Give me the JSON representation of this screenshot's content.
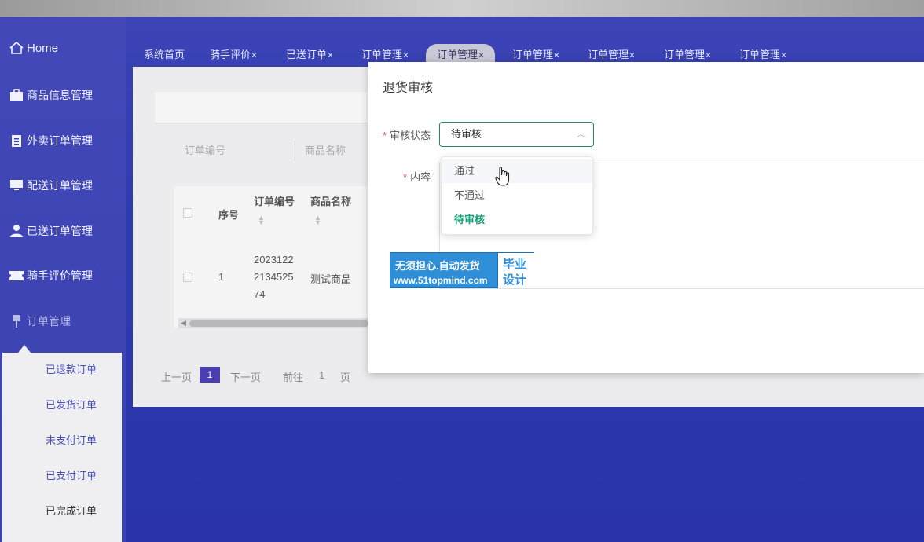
{
  "sidebar": {
    "home": "Home",
    "items": [
      {
        "label": "商品信息管理",
        "icon": "briefcase-icon"
      },
      {
        "label": "外卖订单管理",
        "icon": "clipboard-icon"
      },
      {
        "label": "配送订单管理",
        "icon": "monitor-icon"
      },
      {
        "label": "已送订单管理",
        "icon": "user-icon"
      },
      {
        "label": "骑手评价管理",
        "icon": "ticket-icon"
      },
      {
        "label": "订单管理",
        "icon": "pin-icon"
      }
    ],
    "submenu": [
      "已退款订单",
      "已发货订单",
      "未支付订单",
      "已支付订单",
      "已完成订单"
    ]
  },
  "tabs": [
    {
      "label": "系统首页",
      "close": ""
    },
    {
      "label": "骑手评价",
      "close": "×"
    },
    {
      "label": "已送订单",
      "close": "×"
    },
    {
      "label": "订单管理",
      "close": "×"
    },
    {
      "label": "订单管理",
      "close": "×"
    },
    {
      "label": "订单管理",
      "close": "×"
    },
    {
      "label": "订单管理",
      "close": "×"
    },
    {
      "label": "订单管理",
      "close": "×"
    },
    {
      "label": "订单管理",
      "close": "×"
    }
  ],
  "search": {
    "order_no": "订单编号",
    "product_name": "商品名称"
  },
  "table": {
    "headers": [
      "序号",
      "订单编号",
      "商品名称"
    ],
    "rows": [
      {
        "index": "1",
        "order_no_lines": [
          "2023122",
          "2134525",
          "74"
        ],
        "product": "测试商品"
      }
    ]
  },
  "pager": {
    "prev": "上一页",
    "page": "1",
    "next": "下一页",
    "goto": "前往",
    "goto_value": "1",
    "page_unit": "页"
  },
  "modal": {
    "title": "退货审核",
    "status_label": "审核状态",
    "content_label": "内容",
    "required_mark": "*",
    "status_value": "待审核",
    "options": [
      "通过",
      "不通过",
      "待审核"
    ],
    "selected_option": "待审核"
  },
  "watermark": {
    "line1": "无须担心.自动发货",
    "line2": "www.51topmind.com",
    "badge1": "毕业",
    "badge2": "设计"
  }
}
